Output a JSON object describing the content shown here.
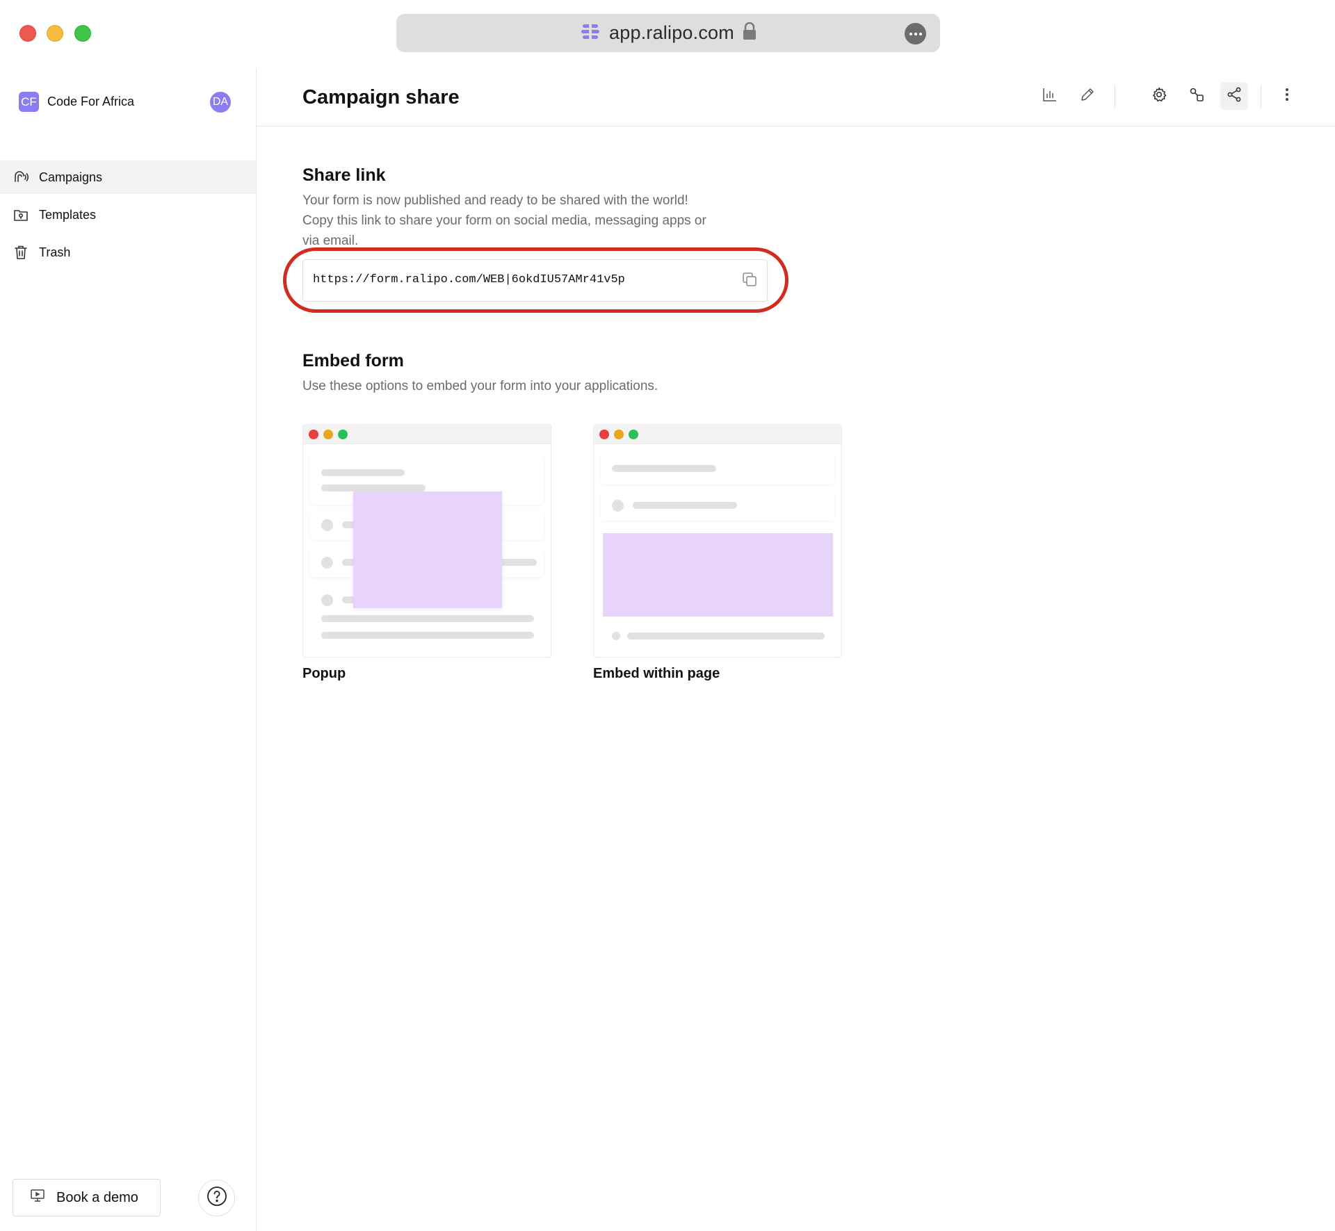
{
  "browser": {
    "url": "app.ralipo.com",
    "icons": {
      "site": "ralipo-logo-icon",
      "lock": "lock-icon",
      "more": "more-options-icon"
    }
  },
  "sidebar": {
    "org_badge": "CF",
    "org_name": "Code For Africa",
    "avatar": "DA",
    "items": [
      {
        "label": "Campaigns",
        "icon": "campaigns-icon",
        "active": true
      },
      {
        "label": "Templates",
        "icon": "templates-folder-icon",
        "active": false
      },
      {
        "label": "Trash",
        "icon": "trash-icon",
        "active": false
      }
    ],
    "book_demo_label": "Book a demo",
    "help_icon": "help-icon"
  },
  "header": {
    "title": "Campaign share",
    "toolbar": [
      "analytics-icon",
      "edit-icon",
      "settings-icon",
      "integrations-icon",
      "share-icon",
      "more-vertical-icon"
    ],
    "active_tool": "share-icon"
  },
  "share": {
    "title": "Share link",
    "description_lines": [
      "Your form is now published and ready to be shared with the world!",
      "Copy this link to share your form on social media, messaging apps or",
      "via email."
    ],
    "link": "https://form.ralipo.com/WEB|6okdIU57AMr41v5p",
    "copy_icon": "copy-icon"
  },
  "embed": {
    "title": "Embed form",
    "description": "Use these options to embed your form into your applications.",
    "options": [
      {
        "label": "Popup"
      },
      {
        "label": "Embed within page"
      }
    ]
  },
  "colors": {
    "accent": "#8b7cf2",
    "highlight": "#d22b1f",
    "embed_purple": "#e8d4fb"
  }
}
